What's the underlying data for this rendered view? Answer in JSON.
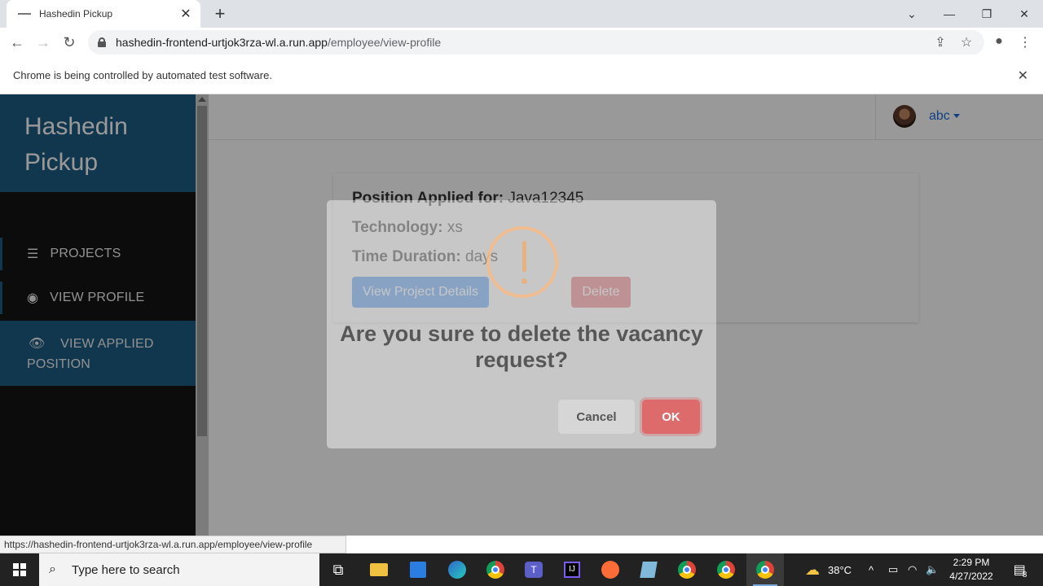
{
  "browser": {
    "tab_title": "Hashedin Pickup",
    "url_host": "hashedin-frontend-urtjok3rza-wl.a.run.app",
    "url_path": "/employee/view-profile",
    "infobar_text": "Chrome is being controlled by automated test software.",
    "status_url": "https://hashedin-frontend-urtjok3rza-wl.a.run.app/employee/view-profile"
  },
  "sidebar": {
    "brand": "Hashedin Pickup",
    "items": [
      {
        "label": "PROJECTS",
        "icon": "list-icon"
      },
      {
        "label": "VIEW PROFILE",
        "icon": "user-circle-icon"
      },
      {
        "label": "VIEW APPLIED POSITION",
        "icon": "eye-icon",
        "active": true
      }
    ]
  },
  "header": {
    "user_name": "abc"
  },
  "card": {
    "position_label": "Position Applied for:",
    "position_value": "Java12345",
    "technology_label": "Technology:",
    "technology_value": "xs",
    "duration_label": "Time Duration:",
    "duration_value": "days",
    "view_button": "View Project Details",
    "delete_button": "Delete"
  },
  "modal": {
    "title": "Are you sure to delete the vacancy request?",
    "cancel_button": "Cancel",
    "ok_button": "OK",
    "warn_color": "#f8bb86"
  },
  "taskbar": {
    "search_placeholder": "Type here to search",
    "temperature": "38°C",
    "time": "2:29 PM",
    "date": "4/27/2022",
    "notification_count": "8"
  }
}
